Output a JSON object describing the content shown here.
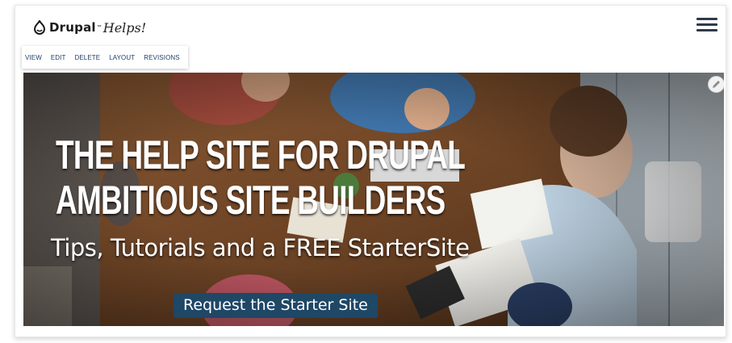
{
  "header": {
    "logo_word": "Drupal",
    "logo_tm": "™",
    "logo_script": "Helps!",
    "menu_icon": "hamburger-icon"
  },
  "tabs": [
    {
      "label": "VIEW"
    },
    {
      "label": "EDIT"
    },
    {
      "label": "DELETE"
    },
    {
      "label": "LAYOUT"
    },
    {
      "label": "REVISIONS"
    }
  ],
  "hero": {
    "headline_line1": "THE HELP SITE FOR DRUPAL",
    "headline_line2": "AMBITIOUS SITE BUILDERS",
    "subtitle": "Tips, Tutorials and a FREE StarterSite",
    "cta_label": "Request the Starter Site",
    "edit_icon": "pencil-icon"
  },
  "colors": {
    "tab_text": "#1e3d6b",
    "hamburger": "#2f3a4b",
    "cta_bg": "#1f4766",
    "cta_text": "#ffffff"
  }
}
